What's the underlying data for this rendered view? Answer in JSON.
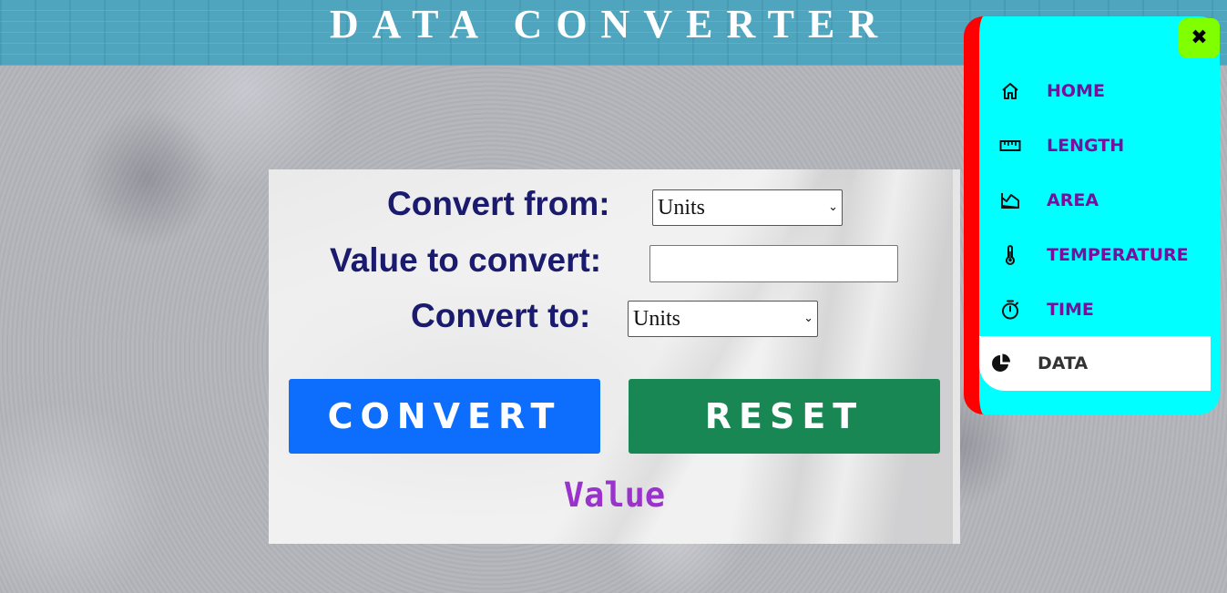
{
  "header": {
    "title": "DATA CONVERTER"
  },
  "converter": {
    "from_label": "Convert from:",
    "from_selected": "Units",
    "value_label": "Value to convert:",
    "value_input": "",
    "to_label": "Convert to:",
    "to_selected": "Units",
    "convert_button": "CONVERT",
    "reset_button": "RESET",
    "output": "Value"
  },
  "sidenav": {
    "close_glyph": "✖",
    "items": [
      {
        "label": "HOME",
        "icon": "home-icon"
      },
      {
        "label": "LENGTH",
        "icon": "ruler-icon"
      },
      {
        "label": "AREA",
        "icon": "area-icon"
      },
      {
        "label": "TEMPERATURE",
        "icon": "thermometer-icon"
      },
      {
        "label": "TIME",
        "icon": "stopwatch-icon"
      },
      {
        "label": "DATA",
        "icon": "pie-chart-icon",
        "active": true
      }
    ]
  },
  "colors": {
    "header_bg": "#4ea5bd",
    "label_text": "#1a1a6e",
    "convert_button": "#0d6efd",
    "reset_button": "#198754",
    "output_text": "#9933cc",
    "sidenav_bg": "#00ffff",
    "sidenav_border": "#ff0000",
    "close_button": "#7fff00",
    "nav_text": "#7a0e9e"
  }
}
